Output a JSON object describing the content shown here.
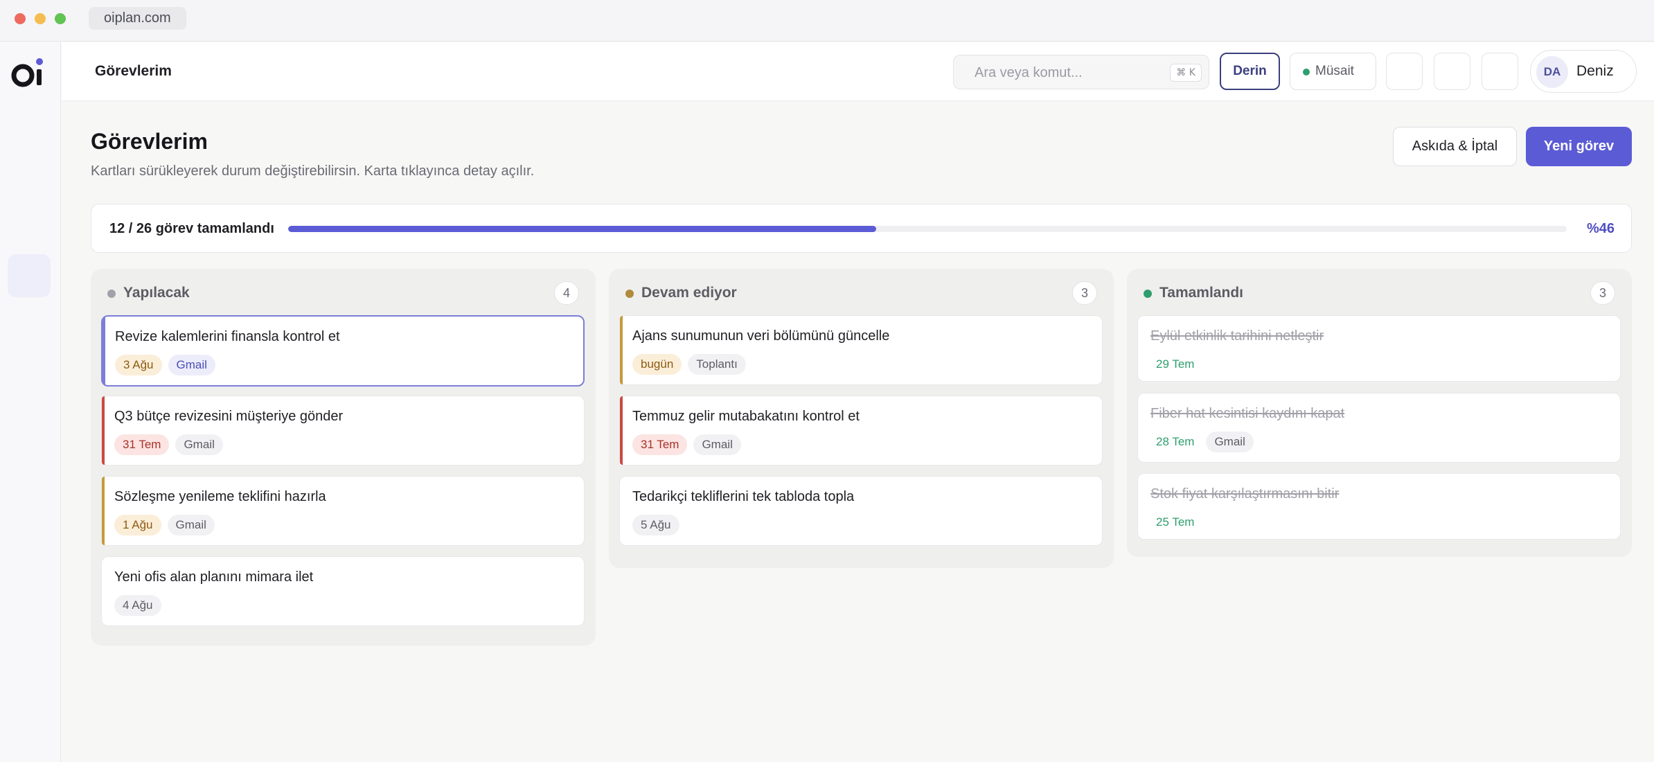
{
  "browser": {
    "url": "oiplan.com"
  },
  "header": {
    "title": "Görevlerim",
    "search_placeholder": "Ara veya komut...",
    "search_shortcut": "⌘ K",
    "mode_label": "Derin",
    "status_label": "Müsait",
    "user_initials": "DA",
    "user_name": "Deniz"
  },
  "page": {
    "title": "Görevlerim",
    "subtitle": "Kartları sürükleyerek durum değiştirebilirsin. Karta tıklayınca detay açılır.",
    "secondary_button": "Askıda & İptal",
    "primary_button": "Yeni görev"
  },
  "progress": {
    "text": "12 / 26 görev tamamlandı",
    "percent_label": "%46",
    "fraction": 0.46
  },
  "colors": {
    "accent": "#5b5bd6",
    "todo": "#a1a1a9",
    "in_progress": "#b08a3e",
    "done": "#2f9e6e",
    "bar_red": "#c94a42",
    "bar_amber": "#c49a3c",
    "bar_violet": "#7d7ed8"
  },
  "columns": [
    {
      "title": "Yapılacak",
      "count": "4",
      "cards": [
        {
          "title": "Revize kalemlerini finansla kontrol et",
          "tags": [
            "3 Ağu",
            "Gmail"
          ]
        },
        {
          "title": "Q3 bütçe revizesini müşteriye gönder",
          "tags": [
            "31 Tem",
            "Gmail"
          ]
        },
        {
          "title": "Sözleşme yenileme teklifini hazırla",
          "tags": [
            "1 Ağu",
            "Gmail"
          ]
        },
        {
          "title": "Yeni ofis alan planını mimara ilet",
          "tags": [
            "4 Ağu"
          ]
        }
      ]
    },
    {
      "title": "Devam ediyor",
      "count": "3",
      "cards": [
        {
          "title": "Ajans sunumunun veri bölümünü güncelle",
          "tags": [
            "bugün",
            "Toplantı"
          ]
        },
        {
          "title": "Temmuz gelir mutabakatını kontrol et",
          "tags": [
            "31 Tem",
            "Gmail"
          ]
        },
        {
          "title": "Tedarikçi tekliflerini tek tabloda topla",
          "tags": [
            "5 Ağu"
          ]
        }
      ]
    },
    {
      "title": "Tamamlandı",
      "count": "3",
      "cards": [
        {
          "title": "Eylül etkinlik tarihini netleştir",
          "tags": [
            "29 Tem"
          ]
        },
        {
          "title": "Fiber hat kesintisi kaydını kapat",
          "tags": [
            "28 Tem",
            "Gmail"
          ]
        },
        {
          "title": "Stok fiyat karşılaştırmasını bitir",
          "tags": [
            "25 Tem"
          ]
        }
      ]
    }
  ]
}
